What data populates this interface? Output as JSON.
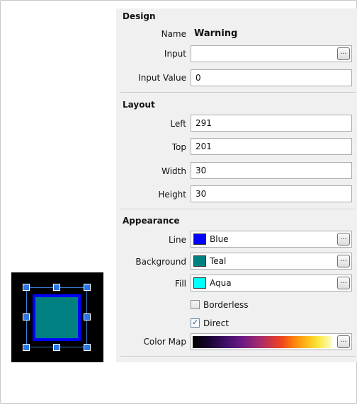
{
  "design": {
    "title": "Design",
    "name_label": "Name",
    "name_value": "Warning",
    "input_label": "Input",
    "input_value": "",
    "input_value_label": "Input Value",
    "input_value_value": "0",
    "ellipsis": "..."
  },
  "layout": {
    "title": "Layout",
    "left_label": "Left",
    "left_value": "291",
    "top_label": "Top",
    "top_value": "201",
    "width_label": "Width",
    "width_value": "30",
    "height_label": "Height",
    "height_value": "30"
  },
  "appearance": {
    "title": "Appearance",
    "line_label": "Line",
    "line_value": "Blue",
    "line_color": "#0000ff",
    "background_label": "Background",
    "background_value": "Teal",
    "background_color": "#008080",
    "fill_label": "Fill",
    "fill_value": "Aqua",
    "fill_color": "#00ffff",
    "borderless_label": "Borderless",
    "borderless_checked": false,
    "direct_label": "Direct",
    "direct_checked": true,
    "colormap_label": "Color Map",
    "ellipsis": "..."
  },
  "preview": {
    "shape_line_color": "#0000ff",
    "shape_fill_color": "#008080",
    "handle_color": "#2a78e4"
  }
}
